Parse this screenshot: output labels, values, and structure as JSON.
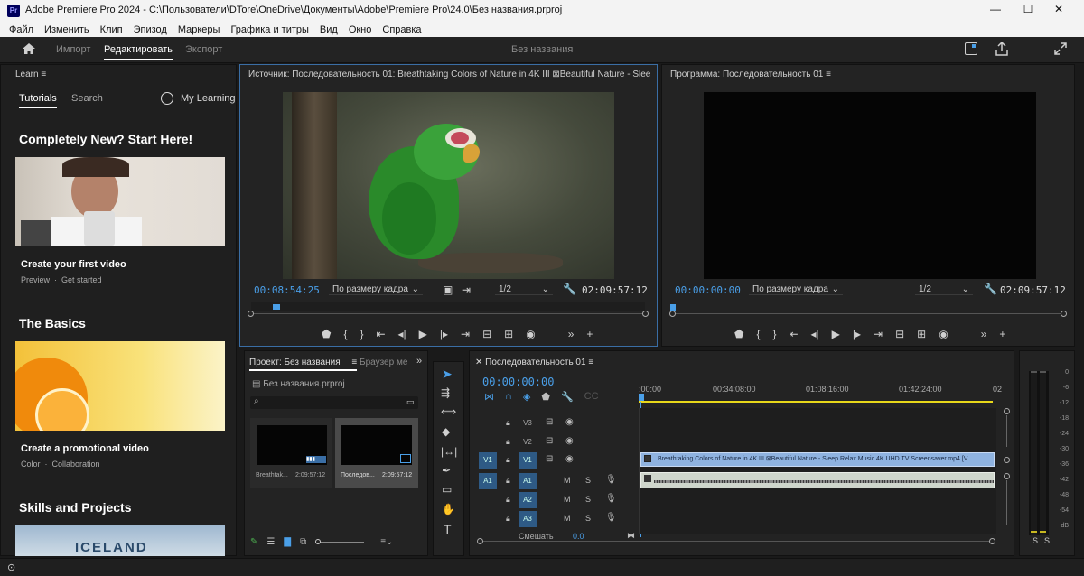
{
  "window": {
    "title": "Adobe Premiere Pro 2024 - C:\\Пользователи\\DTore\\OneDrive\\Документы\\Adobe\\Premiere Pro\\24.0\\Без названия.prproj",
    "minimize": "—",
    "maximize": "☐",
    "close": "✕"
  },
  "menu": [
    "Файл",
    "Изменить",
    "Клип",
    "Эпизод",
    "Маркеры",
    "Графика и титры",
    "Вид",
    "Окно",
    "Справка"
  ],
  "workspace": {
    "tabs": [
      "Импорт",
      "Редактировать",
      "Экспорт"
    ],
    "active": "Редактировать",
    "project_title": "Без названия"
  },
  "learn": {
    "header": "Learn",
    "tabs": [
      "Tutorials",
      "Search"
    ],
    "my_learning": "My Learning",
    "sections": [
      {
        "title": "Completely New? Start Here!",
        "card_title": "Create your first video",
        "card_meta": "Preview  ·  Get started"
      },
      {
        "title": "The Basics",
        "card_title": "Create a promotional video",
        "card_meta": "Color  ·  Collaboration"
      },
      {
        "title": "Skills and Projects",
        "card_image_text": "ICELAND"
      }
    ]
  },
  "source": {
    "header": "Источник: Последовательность 01: Breathtaking Colors of Nature in 4K III ⊠Beautiful Nature - Sleep Relax Mu",
    "timecode": "00:08:54:25",
    "fit": "По размеру кадра",
    "res": "1/2",
    "duration": "02:09:57:12"
  },
  "program": {
    "header": "Программа: Последовательность 01",
    "timecode": "00:00:00:00",
    "fit": "По размеру кадра",
    "res": "1/2",
    "duration": "02:09:57:12"
  },
  "project": {
    "tab": "Проект: Без названия",
    "tab2": "Браузер ме",
    "file": "Без названия.prproj",
    "items": [
      {
        "name": "Breathtak...",
        "dur": "2:09:57:12"
      },
      {
        "name": "Последов...",
        "dur": "2:09:57:12"
      }
    ]
  },
  "timeline": {
    "tab": "Последовательность 01",
    "timecode": "00:00:00:00",
    "ruler": [
      ":00:00",
      "00:34:08:00",
      "01:08:16:00",
      "01:42:24:00",
      "02"
    ],
    "video_tracks": [
      "V3",
      "V2",
      "V1"
    ],
    "audio_tracks": [
      "A1",
      "A2",
      "A3"
    ],
    "src_v": "V1",
    "src_a": "A1",
    "clip": "Breathtaking Colors of Nature in 4K III ⊠Beautiful Nature - Sleep Relax Music 4K UHD TV Screensaver.mp4 [V",
    "mix_label": "Смешать",
    "mix_value": "0.0",
    "m": "M",
    "s": "S"
  },
  "meter": {
    "labels": [
      "0",
      "-6",
      "-12",
      "-18",
      "-24",
      "-30",
      "-36",
      "-42",
      "-48",
      "-54",
      "dB"
    ],
    "solo": [
      "S",
      "S"
    ]
  }
}
